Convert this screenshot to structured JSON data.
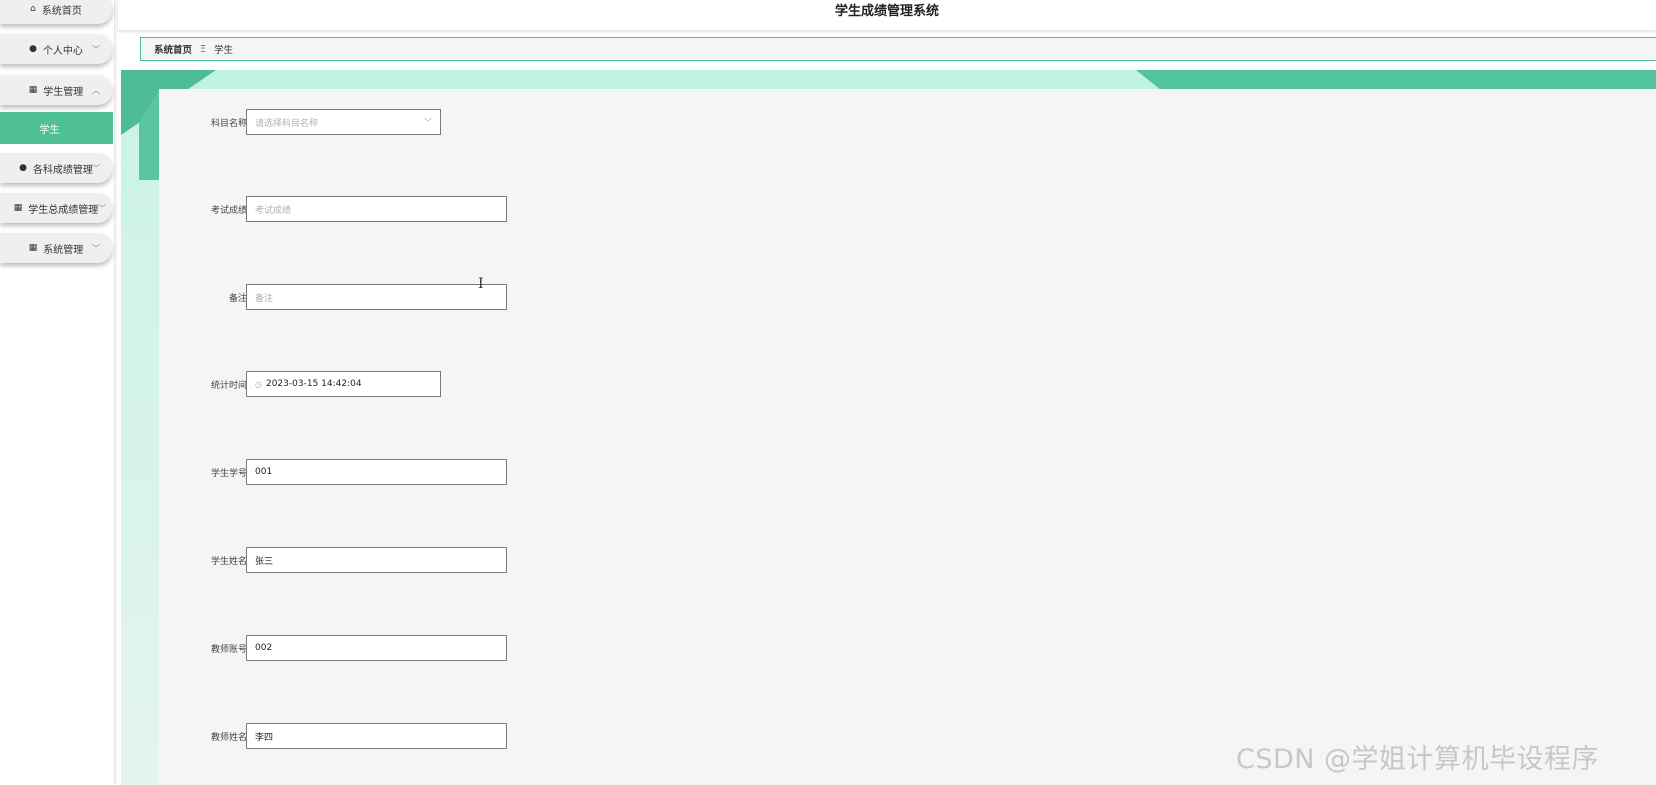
{
  "app": {
    "title": "学生成绩管理系统"
  },
  "sidebar": {
    "items": [
      {
        "label": "系统首页",
        "icon": "home-icon"
      },
      {
        "label": "个人中心",
        "icon": "user-icon"
      },
      {
        "label": "学生管理",
        "icon": "grid-icon"
      },
      {
        "label": "学生",
        "active": true
      },
      {
        "label": "各科成绩管理",
        "icon": "user-icon"
      },
      {
        "label": "学生总成绩管理",
        "icon": "grid-icon"
      },
      {
        "label": "系统管理",
        "icon": "grid-icon"
      }
    ]
  },
  "breadcrumb": {
    "home": "系统首页",
    "separator": "Ξ",
    "current": "学生"
  },
  "form": {
    "subject": {
      "label": "科目名称",
      "placeholder": "请选择科目名称"
    },
    "score": {
      "label": "考试成绩",
      "placeholder": "考试成绩"
    },
    "remark": {
      "label": "备注",
      "placeholder": "备注"
    },
    "stat_time": {
      "label": "统计时间",
      "value": "2023-03-15 14:42:04"
    },
    "student_no": {
      "label": "学生学号",
      "value": "001"
    },
    "student_name": {
      "label": "学生姓名",
      "value": "张三"
    },
    "teacher_no": {
      "label": "教师账号",
      "value": "002"
    },
    "teacher_name": {
      "label": "教师姓名",
      "value": "李四"
    }
  },
  "colors": {
    "accent": "#4fbf96",
    "accent_light": "#c9f3e3"
  },
  "watermark": "CSDN @学姐计算机毕设程序"
}
